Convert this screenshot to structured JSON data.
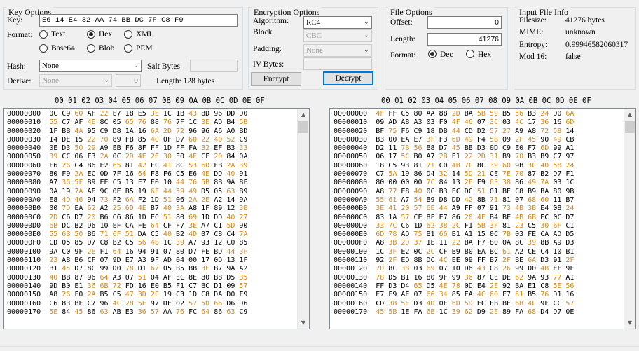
{
  "key_options": {
    "legend": "Key Options",
    "key_label": "Key:",
    "key_value": "E6 14 E4 32 AA 74 BB DC 7F C8 F9",
    "format_label": "Format:",
    "format_options": [
      "Text",
      "Hex",
      "XML",
      "Base64",
      "Blob",
      "PEM"
    ],
    "format_selected": "Hex",
    "hash_label": "Hash:",
    "hash_value": "None",
    "salt_label": "Salt Bytes",
    "derive_label": "Derive:",
    "derive_value": "None",
    "derive_count": "0",
    "length_text": "Length: 128 bytes"
  },
  "encryption_options": {
    "legend": "Encryption Options",
    "algorithm_label": "Algorithm:",
    "algorithm_value": "RC4",
    "block_label": "Block",
    "block_value": "CBC",
    "padding_label": "Padding:",
    "padding_value": "None",
    "iv_label": "IV Bytes:",
    "encrypt_label": "Encrypt",
    "decrypt_label": "Decrypt"
  },
  "file_options": {
    "legend": "File Options",
    "offset_label": "Offset:",
    "offset_value": "0",
    "length_label": "Length:",
    "length_value": "41276",
    "format_label": "Format:",
    "format_options": [
      "Dec",
      "Hex"
    ],
    "format_selected": "Dec"
  },
  "input_file_info": {
    "legend": "Input File Info",
    "rows": [
      {
        "label": "Filesize:",
        "value": "41276 bytes"
      },
      {
        "label": "MIME:",
        "value": "unknown"
      },
      {
        "label": "Entropy:",
        "value": "0.99946582060317"
      },
      {
        "label": "Mod 16:",
        "value": "false"
      }
    ]
  },
  "hex_header": "00 01 02 03 04 05 06 07 08 09 0A 0B 0C 0D 0E 0F",
  "left_hex": [
    "00000000  0C C9 60 AF 22 E7 18 E5 3E 1C 1B 43 8D 96 DD D0",
    "00000010  55 C7 AF 4E 8C 05 65 76 88 76 7F 1C 3E AD B4 5B",
    "00000020  1F BB 4A 95 C9 D8 1A 16 6A 2D 72 96 96 A6 A0 BD",
    "00000030  14 DE 15 22 70 89 FB 85 40 0F D7 60 22 40 52 C9",
    "00000040  0E D3 50 29 A9 EB F6 8F FF 1D FF FA 32 EF B3 33",
    "00000050  39 CC 06 F3 2A 0C 2D 4E 2E 30 E0 4E CF 20 84 0A",
    "00000060  F6 26 C4 B6 E2 65 81 42 FC 41 8C 53 6D FB 2A 39",
    "00000070  80 F9 2A EC 0D 7F 16 64 F8 F6 C5 E6 4E DD 40 91",
    "00000080  A7 36 5F B9 EE C5 13 F7 E0 10 44 76 5B 8B 9A 8F",
    "00000090  0A 19 7A AE 9C 0E B5 19 6F 44 59 49 D5 05 63 B9",
    "000000A0  E8 4D 46 94 73 F2 6A F2 1D 51 06 2A 2E A2 14 9A",
    "000000B0  00 7D EA 62 A2 25 6D 4E B7 40 3A A8 1F 89 12 3B",
    "000000C0  2D C6 D7 20 B6 C6 86 1D EC 51 80 69 1D DD 40 27",
    "000000D0  6B DC B2 D6 10 EF CA FE 64 CF F7 3E A7 C1 5D 90",
    "000000E0  55 6B 50 B6 71 6F 51 DA C5 40 B2 4D 07 C8 C4 7A",
    "000000F0  CD 05 85 D7 C8 B2 C5 56 48 1C 39 A7 93 12 C0 85",
    "00000100  9A C0 9F 2E F1 64 16 94 91 07 80 D7 FE BD 44 3F",
    "00000110  23 A8 B6 CF 07 9D E7 A3 9F AD 04 00 17 0D 13 1F",
    "00000120  B1 45 D7 8C 99 D0 78 D1 67 05 B5 BB 3F B7 9A A2",
    "00000130  40 BB 87 96 64 A3 07 51 04 AF EC 8E 80 B8 D5 35",
    "00000140  9D B0 E1 36 6B 72 FD 16 E0 B5 F1 C7 BC D1 09 57",
    "00000150  A8 26 F0 2A B5 C5 47 3D 2C 19 C3 1D C8 DA D0 F9",
    "00000160  C6 83 BF C7 96 4C 28 5E 97 DE 02 57 5D 66 D6 D6",
    "00000170  5E 84 45 86 63 AB E3 36 57 AA 76 FC 64 86 63 C9"
  ],
  "right_hex": [
    "00000000  4F FF C5 80 AA 88 2D BA 5B 59 B5 56 B3 24 D0 6A",
    "00000010  09 AD A8 A3 03 F0 4F 46 07 3C 03 4C 17 36 16 6D",
    "00000020  BF 75 F6 C9 18 DB 44 CD D2 57 27 A9 A8 72 58 14",
    "00000030  B3 00 EA E7 3F F3 6D 49 F4 5B 09 2F 45 90 49 CB",
    "00000040  D2 11 7B 56 B8 D7 45 BB D3 0D C9 E0 F7 6D 99 A1",
    "00000050  06 17 5C B0 A7 2B E1 22 2D 31 B9 70 B3 B9 C7 97",
    "00000060  18 C5 93 81 71 C0 4B 7C 8C 39 60 9B 3C 40 58 24",
    "00000070  C7 5A 19 86 D4 32 14 5D 21 CE 7E 70 87 B2 D7 F1",
    "00000080  80 00 00 00 7C 84 13 2E E9 63 38 86 49 7A 03 1C",
    "00000090  A8 77 E8 40 0C B3 EC DC 51 01 BE C8 B9 BA 80 9B",
    "000000A0  55 61 A7 54 B9 D8 DD 42 8B 71 81 07 68 60 11 B7",
    "000000B0  3E 41 20 57 6E 44 A9 FF 07 91 73 4B 3B E4 08 24",
    "000000C0  83 1A 57 CE 8F E7 86 20 4F B4 BF 4B 6B EC 0C D7",
    "000000D0  33 7C C6 1D 62 38 2C F1 5B 3F 81 23 C5 30 6F C1",
    "000000E0  6D 78 AD 75 B1 66 B1 A1 15 0C 7B 03 FE CA AD D5",
    "000000F0  A8 3B 2D 37 1E 11 22 BA F7 80 0A 8C 39 8B A9 D3",
    "00000100  1C 3F E2 0C 2C CF B9 B0 EA BC 61 A2 CE C4 10 B1",
    "00000110  92 2F ED 8B DC 4C EE 09 FF B7 2F BE 6A D3 91 2F",
    "00000120  7D 8C 38 03 69 07 10 D6 43 C8 26 99 00 4B EF 9F",
    "00000130  78 D5 B1 16 80 9F 99 36 87 CE DE 62 9A 93 77 A1",
    "00000140  FF D3 D4 65 D5 4E 78 0D E4 2E 92 BA E1 C8 5E 56",
    "00000150  E7 F9 AE 07 66 34 85 EA 4C 60 F7 61 B5 76 D1 16",
    "00000160  CD 38 5E D3 4D 0F 6D 5D EC FB BE 68 4C 9F CC 57",
    "00000170  45 5B 1E FA 6B 1C 39 62 D9 2E 89 FA 68 D4 D7 0E"
  ]
}
